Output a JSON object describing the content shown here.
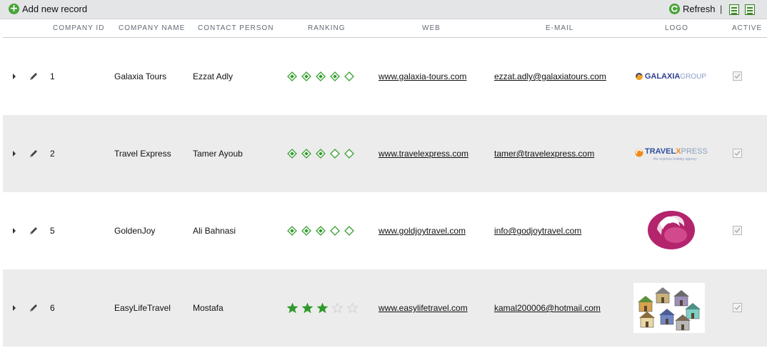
{
  "toolbar": {
    "add_label": "Add new record",
    "refresh_label": "Refresh",
    "separator": "|"
  },
  "columns": {
    "company_id": "COMPANY ID",
    "company_name": "COMPANY NAME",
    "contact_person": "CONTACT PERSON",
    "ranking": "RANKING",
    "web": "WEB",
    "email": "E-MAIL",
    "logo": "LOGO",
    "active": "ACTIVE"
  },
  "rows": [
    {
      "id": "1",
      "name": "Galaxia Tours",
      "contact": "Ezzat Adly",
      "ranking": 4,
      "ranking_style": "diamond",
      "web": "www.galaxia-tours.com",
      "email": "ezzat.adly@galaxiatours.com",
      "active": true,
      "logo": {
        "kind": "galaxia",
        "text_a": "GALAXIA",
        "text_b": "GROUP"
      }
    },
    {
      "id": "2",
      "name": "Travel Express",
      "contact": "Tamer Ayoub",
      "ranking": 3,
      "ranking_style": "diamond",
      "web": "www.travelexpress.com",
      "email": "tamer@travelexpress.com",
      "active": true,
      "logo": {
        "kind": "travelexpress",
        "text_a": "TRAVEL",
        "text_b": "X",
        "text_c": "PRESS",
        "tagline": "the express holiday agency"
      }
    },
    {
      "id": "5",
      "name": "GoldenJoy",
      "contact": "Ali Bahnasi",
      "ranking": 3,
      "ranking_style": "diamond",
      "web": "www.goldjoytravel.com",
      "email": "info@godjoytravel.com",
      "active": true,
      "logo": {
        "kind": "goldenjoy"
      }
    },
    {
      "id": "6",
      "name": "EasyLifeTravel",
      "contact": "Mostafa",
      "ranking": 3,
      "ranking_style": "star",
      "web": "www.easylifetravel.com",
      "email": "kamal200006@hotmail.com",
      "active": true,
      "logo": {
        "kind": "easylife"
      }
    }
  ],
  "rating_max": 5,
  "colors": {
    "rating_fill": "#2f9a2a",
    "rating_stroke": "#39a032",
    "star_empty": "#cfcfcf",
    "link": "#1d4f9c",
    "alt_row": "#ececec"
  }
}
